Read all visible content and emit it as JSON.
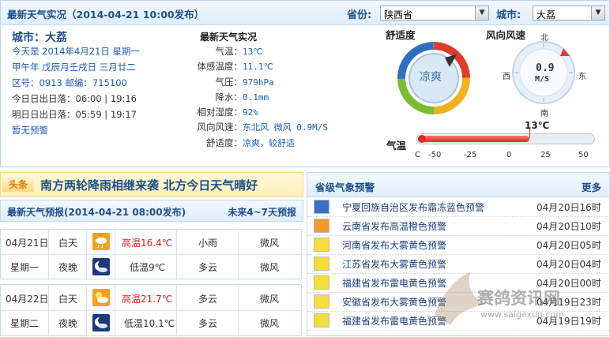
{
  "top": {
    "title": "最新天气实况（2014-04-21 10:00发布）",
    "province_label": "省份:",
    "province_value": "陕西省",
    "city_label": "城市:",
    "city_value": "大荔"
  },
  "info": {
    "city": "城市：大荔",
    "today": "今天是 2014年4月21日 星期一",
    "lunar": "甲午年 戊辰月壬戌日 三月廿二",
    "codes": "区号：0913  邮编：715100",
    "today_sun": "今日日出日落：06:00 | 19:16",
    "tomorrow_sun": "明日日出日落：05:59 | 19:17",
    "alert": "暂无预警"
  },
  "live": {
    "title": "最新天气实况",
    "rows": [
      {
        "label": "气温：",
        "value": "13℃"
      },
      {
        "label": "体感温度：",
        "value": "11.1℃"
      },
      {
        "label": "气压：",
        "value": "979hPa"
      },
      {
        "label": "降水：",
        "value": "0.1mm"
      },
      {
        "label": "相对湿度：",
        "value": "92%"
      },
      {
        "label": "风向风速：",
        "value": "东北风 微风 0.9M/S"
      },
      {
        "label": "舒适度：",
        "value": "凉爽，较舒适"
      }
    ]
  },
  "comfort": {
    "title": "舒适度",
    "value": "凉爽"
  },
  "wind": {
    "title": "风向风速",
    "speed": "0.9",
    "unit": "M/S",
    "n": "北",
    "s": "南",
    "e": "东",
    "w": "西"
  },
  "thermo": {
    "label": "气温",
    "current": "13℃",
    "unit": "C",
    "current_value": 13,
    "min": -50,
    "max": 50,
    "ticks": [
      "-50",
      "-25",
      "0",
      "25",
      "50"
    ]
  },
  "headline": {
    "badge": "头条",
    "text": "南方两轮降雨相继来袭  北方今日天气晴好"
  },
  "forecast": {
    "title": "最新天气预报(2014-04-21 08:00发布)",
    "link": "未来4~7天预报",
    "days": [
      {
        "date": "04月21日",
        "weekday": "星期一",
        "day": {
          "period": "白天",
          "temp": "高温16.4℃",
          "weather": "小雨",
          "wind": "微风"
        },
        "night": {
          "period": "夜晚",
          "temp": "低温9℃",
          "weather": "多云",
          "wind": "微风"
        }
      },
      {
        "date": "04月22日",
        "weekday": "星期二",
        "day": {
          "period": "白天",
          "temp": "高温21.7℃",
          "weather": "多云",
          "wind": "微风"
        },
        "night": {
          "period": "夜晚",
          "temp": "低温10.1℃",
          "weather": "多云",
          "wind": "微风"
        }
      }
    ]
  },
  "warnings": {
    "title": "省级气象预警",
    "more": "更多",
    "items": [
      {
        "text": "宁夏回族自治区发布霜冻蓝色预警",
        "date": "04月20日16时",
        "color": "#3a6fc4"
      },
      {
        "text": "云南省发布高温橙色预警",
        "date": "04月20日10时",
        "color": "#f29a2e"
      },
      {
        "text": "河南省发布大雾黄色预警",
        "date": "04月20日05时",
        "color": "#f4df3a"
      },
      {
        "text": "江苏省发布大雾黄色预警",
        "date": "04月20日04时",
        "color": "#f4df3a"
      },
      {
        "text": "福建省发布雷电黄色预警",
        "date": "04月20日00时",
        "color": "#f4df3a"
      },
      {
        "text": "安徽省发布大雾黄色预警",
        "date": "04月19日23时",
        "color": "#f4df3a"
      },
      {
        "text": "福建省发布雷电黄色预警",
        "date": "04月19日19时",
        "color": "#f4df3a"
      }
    ]
  },
  "watermark": {
    "text": "赛鸽资讯网",
    "url": "www.saigexun.com"
  }
}
